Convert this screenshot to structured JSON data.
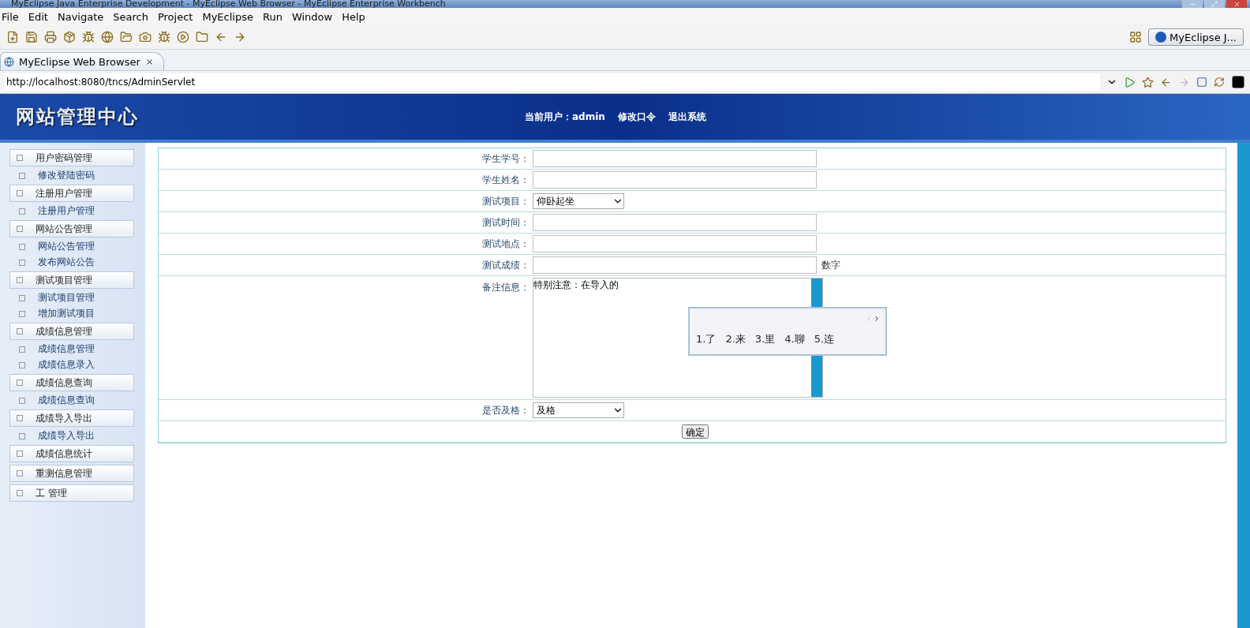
{
  "window": {
    "title": "MyEclipse Java Enterprise Development - MyEclipse Web Browser - MyEclipse Enterprise Workbench"
  },
  "menu": [
    "File",
    "Edit",
    "Navigate",
    "Search",
    "Project",
    "MyEclipse",
    "Run",
    "Window",
    "Help"
  ],
  "perspective": {
    "label": "MyEclipse J..."
  },
  "editor_tab": {
    "label": "MyEclipse Web Browser"
  },
  "address": {
    "value": "http://localhost:8080/tncs/AdminServlet"
  },
  "header": {
    "site_title": "网站管理中心",
    "user_label": "当前用户：admin",
    "links": [
      "修改口令",
      "退出系统"
    ]
  },
  "sidebar": [
    {
      "kind": "group",
      "label": "用户密码管理"
    },
    {
      "kind": "link",
      "label": "修改登陆密码"
    },
    {
      "kind": "group",
      "label": "注册用户管理"
    },
    {
      "kind": "link",
      "label": "注册用户管理"
    },
    {
      "kind": "group",
      "label": "网站公告管理"
    },
    {
      "kind": "link",
      "label": "网站公告管理"
    },
    {
      "kind": "link",
      "label": "发布网站公告"
    },
    {
      "kind": "group",
      "label": "测试项目管理"
    },
    {
      "kind": "link",
      "label": "测试项目管理"
    },
    {
      "kind": "link",
      "label": "增加测试项目"
    },
    {
      "kind": "group",
      "label": "成绩信息管理"
    },
    {
      "kind": "link",
      "label": "成绩信息管理"
    },
    {
      "kind": "link",
      "label": "成绩信息录入"
    },
    {
      "kind": "group",
      "label": "成绩信息查询"
    },
    {
      "kind": "link",
      "label": "成绩信息查询"
    },
    {
      "kind": "group",
      "label": "成绩导入导出"
    },
    {
      "kind": "link",
      "label": "成绩导入导出"
    },
    {
      "kind": "group",
      "label": "成绩信息统计"
    },
    {
      "kind": "group",
      "label": "重测信息管理"
    },
    {
      "kind": "group",
      "label": "工 管理"
    }
  ],
  "form": {
    "rows": [
      {
        "kind": "text",
        "label": "学生学号："
      },
      {
        "kind": "text",
        "label": "学生姓名："
      },
      {
        "kind": "select",
        "label": "测试项目：",
        "value": "仰卧起坐"
      },
      {
        "kind": "text",
        "label": "测试时间："
      },
      {
        "kind": "text",
        "label": "测试地点："
      },
      {
        "kind": "text",
        "label": "测试成绩：",
        "hint": "数字"
      },
      {
        "kind": "textarea",
        "label": "备注信息：",
        "value": "特别注意：在导入的"
      },
      {
        "kind": "select",
        "label": "是否及格：",
        "value": "及格"
      }
    ],
    "submit": "确定"
  },
  "ime": {
    "candidates": [
      "1.了",
      "2.来",
      "3.里",
      "4.聊",
      "5.连"
    ]
  }
}
